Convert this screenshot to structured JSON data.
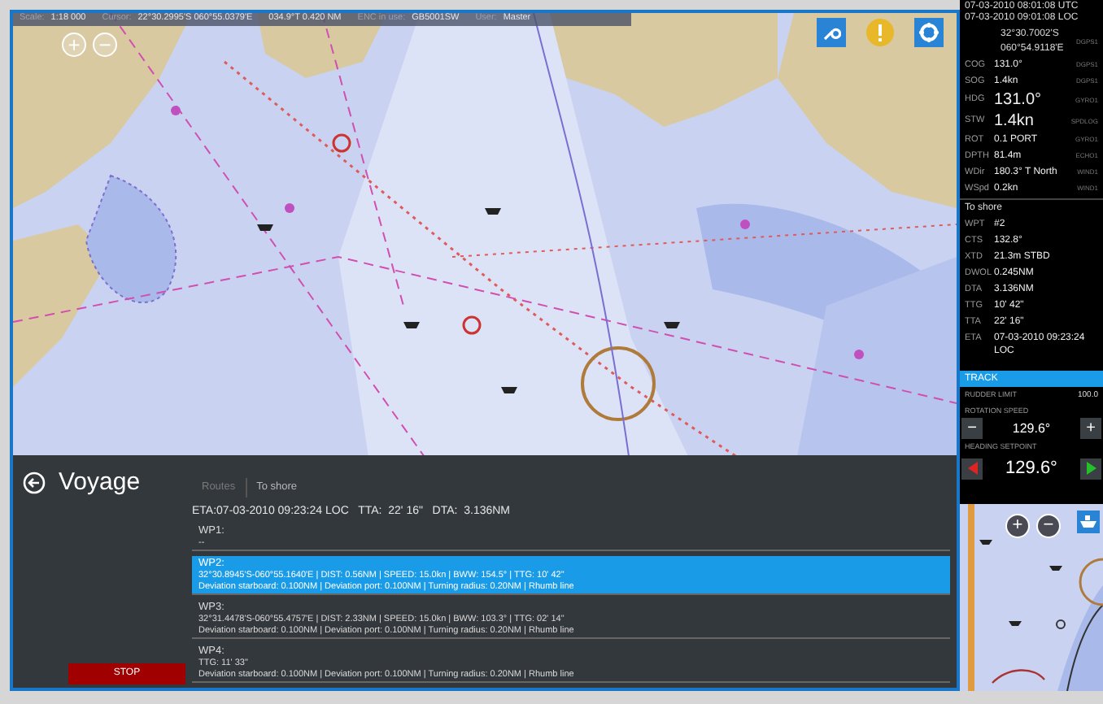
{
  "status_bar": [
    {
      "label": "Scale:",
      "value": "1:18 000"
    },
    {
      "label": "Cursor:",
      "value": "22°30.2995'S 060°55.0379'E"
    },
    {
      "value": "034.9°T 0.420 NM"
    },
    {
      "label": "ENC in use:",
      "value": "GB5001SW"
    },
    {
      "label": "User:",
      "value": "Master"
    }
  ],
  "map_zoom": [
    "+",
    "−"
  ],
  "nav_data": {
    "time_utc": "07-03-2010 08:01:08 UTC",
    "time_loc": "07-03-2010 09:01:08 LOC",
    "position": [
      "32°30.7002'S",
      "060°54.9118'E"
    ],
    "position_source": "DGPS1",
    "rows": [
      {
        "label": "COG",
        "value": "131.0°",
        "source": "DGPS1",
        "large": false
      },
      {
        "label": "SOG",
        "value": "1.4kn",
        "source": "DGPS1",
        "large": false
      },
      {
        "label": "HDG",
        "value": "131.0°",
        "source": "GYRO1",
        "large": true
      },
      {
        "label": "STW",
        "value": "1.4kn",
        "source": "SPDLOG",
        "large": true
      },
      {
        "label": "ROT",
        "value": "0.1 PORT",
        "source": "GYRO1",
        "large": false
      },
      {
        "label": "DPTH",
        "value": "81.4m",
        "source": "ECHO1",
        "large": false
      },
      {
        "label": "WDir",
        "value": "180.3° T North",
        "source": "WIND1",
        "large": false
      },
      {
        "label": "WSpd",
        "value": "0.2kn",
        "source": "WIND1",
        "large": false
      }
    ]
  },
  "to_shore": {
    "title": "To shore",
    "rows": [
      {
        "label": "WPT",
        "value": "#2"
      },
      {
        "label": "CTS",
        "value": "132.8°"
      },
      {
        "label": "XTD",
        "value": "21.3m STBD"
      },
      {
        "label": "DWOL",
        "value": "0.245NM"
      },
      {
        "label": "DTA",
        "value": "3.136NM"
      },
      {
        "label": "TTG",
        "value": "10' 42\""
      },
      {
        "label": "TTA",
        "value": "22' 16\""
      },
      {
        "label": "ETA",
        "value": "07-03-2010 09:23:24 LOC"
      }
    ]
  },
  "track": {
    "title": "TRACK",
    "rudder_limit": {
      "label": "RUDDER LIMIT",
      "value": "100.0"
    },
    "rotation_speed": {
      "label": "ROTATION SPEED",
      "value": "129.6°",
      "minus": "−",
      "plus": "+"
    },
    "heading_setpoint": {
      "label": "HEADING SETPOINT",
      "value": "129.6°"
    }
  },
  "mini_map_zoom": [
    "+",
    "−"
  ],
  "voyage": {
    "title": "Voyage",
    "tabs": [
      {
        "label": "Routes",
        "selected": false
      },
      {
        "label": "To shore",
        "selected": true
      }
    ],
    "summary": "ETA:07-03-2010 09:23:24 LOC   TTA:  22' 16\"   DTA:  3.136NM",
    "waypoints": [
      {
        "name": "WP1:",
        "lines": [
          "--"
        ],
        "selected": false
      },
      {
        "name": "WP2:",
        "lines": [
          "32°30.8945'S-060°55.1640'E | DIST: 0.56NM | SPEED: 15.0kn | BWW: 154.5° | TTG: 10' 42\"",
          "Deviation starboard: 0.100NM | Deviation port: 0.100NM | Turning radius: 0.20NM | Rhumb line"
        ],
        "selected": true
      },
      {
        "name": "WP3:",
        "lines": [
          "32°31.4478'S-060°55.4757'E | DIST: 2.33NM | SPEED: 15.0kn | BWW: 103.3° | TTG: 02' 14\"",
          "Deviation starboard: 0.100NM | Deviation port: 0.100NM | Turning radius: 0.20NM | Rhumb line"
        ],
        "selected": false
      },
      {
        "name": "WP4:",
        "lines": [
          "TTG: 11' 33\"",
          "Deviation starboard: 0.100NM | Deviation port: 0.100NM | Turning radius: 0.20NM | Rhumb line"
        ],
        "selected": false
      }
    ],
    "stop": "STOP"
  }
}
